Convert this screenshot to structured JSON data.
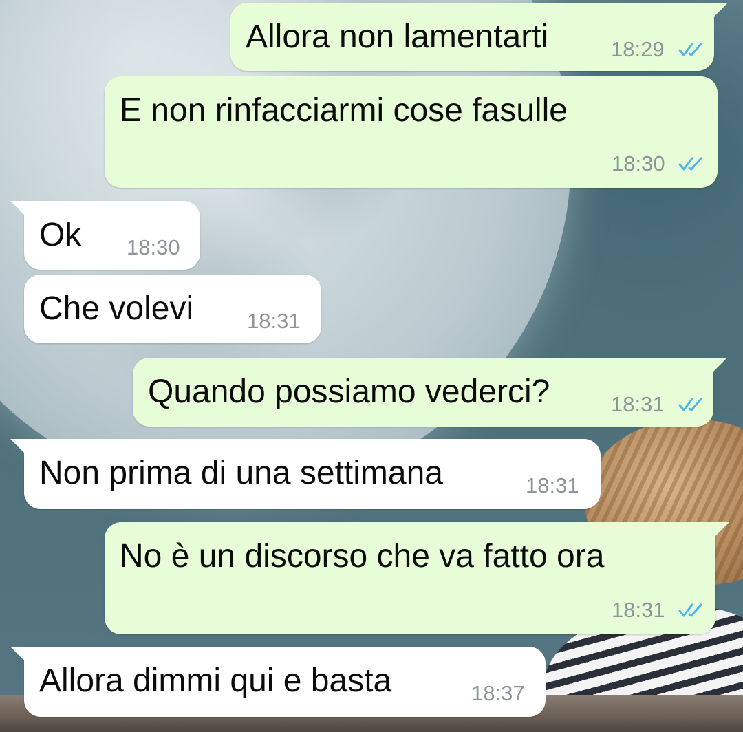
{
  "messages": [
    {
      "direction": "out",
      "text": "Allora non lamentarti",
      "time": "18:29",
      "status": "read"
    },
    {
      "direction": "out",
      "text": "E non rinfacciarmi cose fasulle",
      "time": "18:30",
      "status": "read"
    },
    {
      "direction": "in",
      "text": "Ok",
      "time": "18:30"
    },
    {
      "direction": "in",
      "text": "Che volevi",
      "time": "18:31"
    },
    {
      "direction": "out",
      "text": "Quando possiamo vederci?",
      "time": "18:31",
      "status": "read"
    },
    {
      "direction": "in",
      "text": "Non prima di una settimana",
      "time": "18:31"
    },
    {
      "direction": "out",
      "text": "No è un discorso che va fatto ora",
      "time": "18:31",
      "status": "read"
    },
    {
      "direction": "in",
      "text": "Allora dimmi qui e basta",
      "time": "18:37"
    }
  ],
  "icons": {
    "read_receipt": "double-check-icon"
  },
  "colors": {
    "outgoing_bubble": "#e7fdd7",
    "incoming_bubble": "#ffffff",
    "text": "#0b0b0b",
    "timestamp": "#8e9598",
    "read_ticks": "#4fb5ec"
  }
}
